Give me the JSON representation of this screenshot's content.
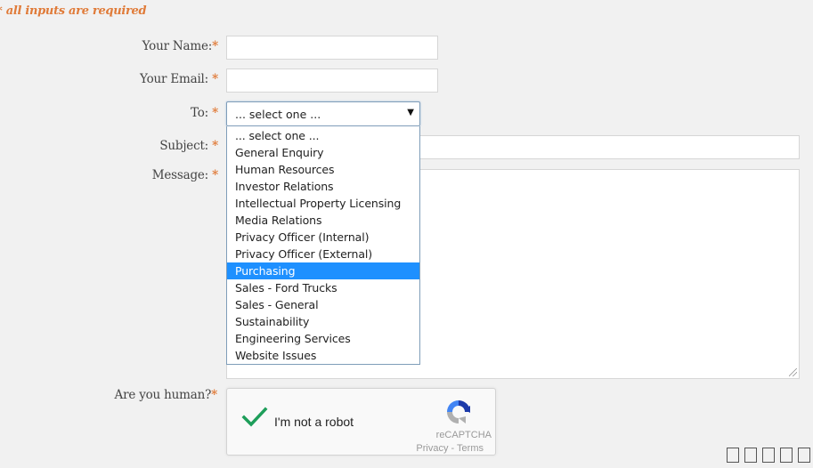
{
  "form": {
    "required_note": "* all inputs are required",
    "fields": {
      "name": {
        "label": "Your Name:",
        "required_marker": "*",
        "value": ""
      },
      "email": {
        "label": "Your Email: ",
        "required_marker": "*",
        "value": ""
      },
      "to": {
        "label": "To: ",
        "required_marker": "*",
        "selected_value": "... select one ...",
        "dropdown_arrow": "▼"
      },
      "subject": {
        "label": "Subject: ",
        "required_marker": "*",
        "value": ""
      },
      "message": {
        "label": "Message: ",
        "required_marker": "*",
        "value": ""
      },
      "captcha": {
        "label": "Are you human?",
        "required_marker": "*"
      }
    },
    "to_options": [
      "... select one ...",
      "General Enquiry",
      "Human Resources",
      "Investor Relations",
      "Intellectual Property Licensing",
      "Media Relations",
      "Privacy Officer (Internal)",
      "Privacy Officer (External)",
      "Purchasing",
      "Sales - Ford Trucks",
      "Sales - General",
      "Sustainability",
      "Engineering Services",
      "Website Issues"
    ],
    "highlighted_option": "Purchasing"
  },
  "recaptcha": {
    "checkbox_label": "I'm not a robot",
    "checked": true,
    "brand": "reCAPTCHA",
    "privacy_link": "Privacy",
    "separator": " - ",
    "terms_link": "Terms",
    "check_color": "#1e9e5a"
  },
  "footer_boxes_count": 5,
  "colors": {
    "accent": "#e07b39",
    "highlight": "#1e90ff",
    "background": "#f1f1f1"
  }
}
